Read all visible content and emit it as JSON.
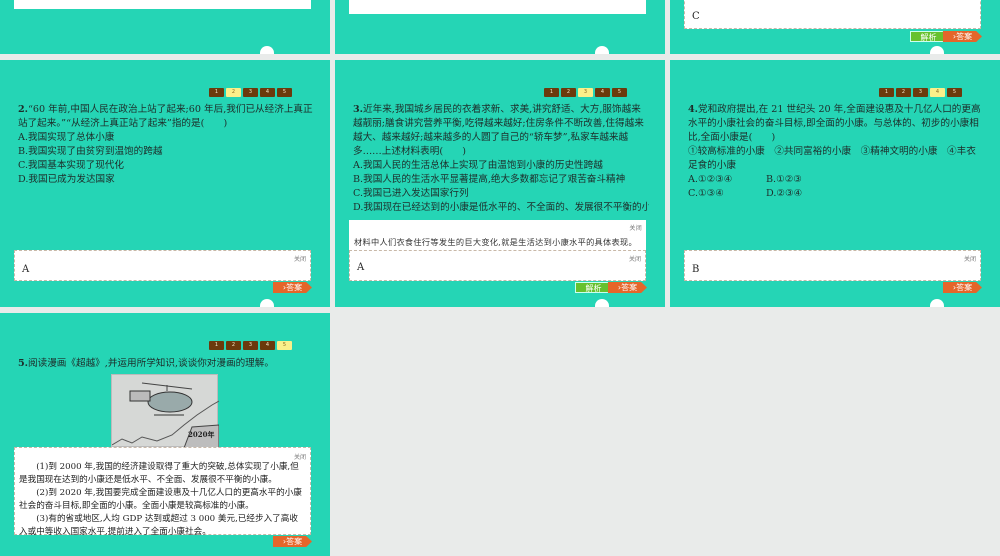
{
  "nav_buttons": [
    "1",
    "2",
    "3",
    "4",
    "5"
  ],
  "common": {
    "close_label": "关闭",
    "answer_label": "›答案",
    "analysis_label": "解析"
  },
  "slides": {
    "r1c3": {
      "answer": "C"
    },
    "q2": {
      "active": 2,
      "number": "2.",
      "stem": "“60 年前,中国人民在政治上站了起来;60 年后,我们已从经济上真正站了起来。”“从经济上真正站了起来”指的是(　　)",
      "options": [
        "A.我国实现了总体小康",
        "B.我国实现了由贫穷到温饱的跨越",
        "C.我国基本实现了现代化",
        "D.我国已成为发达国家"
      ],
      "answer": "A"
    },
    "q3": {
      "active": 3,
      "number": "3.",
      "stem": "近年来,我国城乡居民的衣着求新、求美,讲究舒适、大方,服饰越来越靓丽;膳食讲究营养平衡,吃得越来越好;住房条件不断改善,住得越来越大、越来越好;越来越多的人圆了自己的“轿车梦”,私家车越来越多……上述材料表明(　　)",
      "options": [
        "A.我国人民的生活总体上实现了由温饱到小康的历史性跨越",
        "B.我国人民的生活水平显著提高,绝大多数都忘记了艰苦奋斗精神",
        "C.我国已进入发达国家行列",
        "D.我国现在已经达到的小康是低水平的、不全面的、发展很不平衡的小康"
      ],
      "analysis": "材料中人们衣食住行等发生的巨大变化,就是生活达到小康水平的具体表现。",
      "answer": "A"
    },
    "q4": {
      "active": 4,
      "number": "4.",
      "stem": "党和政府提出,在 21 世纪头 20 年,全面建设惠及十几亿人口的更高水平的小康社会的奋斗目标,即全面的小康。与总体的、初步的小康相比,全面小康是(　　)",
      "items": "①较高标准的小康　②共同富裕的小康　③精神文明的小康　④丰衣足食的小康",
      "options": [
        "A.①②③④",
        "B.①②③",
        "C.①③④",
        "D.②③④"
      ],
      "answer": "B"
    },
    "q5": {
      "active": 5,
      "number": "5.",
      "stem": "阅读漫画《超越》,并运用所学知识,谈谈你对漫画的理解。",
      "comic_text": "2020年",
      "answer_paragraphs": [
        "(1)到 2000 年,我国的经济建设取得了重大的突破,总体实现了小康,但是我国现在达到的小康还是低水平、不全面、发展很不平衡的小康。",
        "(2)到 2020 年,我国要完成全面建设惠及十几亿人口的更高水平的小康社会的奋斗目标,即全面的小康。全面小康是较高标准的小康。",
        "(3)有的省或地区,人均 GDP 达到或超过 3 000 美元,已经步入了高收入或中等收入国家水平,提前进入了全面小康社会。"
      ]
    }
  }
}
